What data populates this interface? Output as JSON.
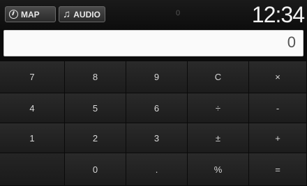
{
  "header": {
    "map_label": "MAP",
    "audio_label": "AUDIO",
    "indicator": "0",
    "clock": "12:34"
  },
  "display": {
    "value": "0"
  },
  "keypad": {
    "k7": "7",
    "k8": "8",
    "k9": "9",
    "clear": "C",
    "multiply": "×",
    "k4": "4",
    "k5": "5",
    "k6": "6",
    "divide": "÷",
    "minus": "-",
    "k1": "1",
    "k2": "2",
    "k3": "3",
    "plusminus": "±",
    "plus": "+",
    "k0": "0",
    "decimal": ".",
    "percent": "%",
    "equals": "="
  }
}
